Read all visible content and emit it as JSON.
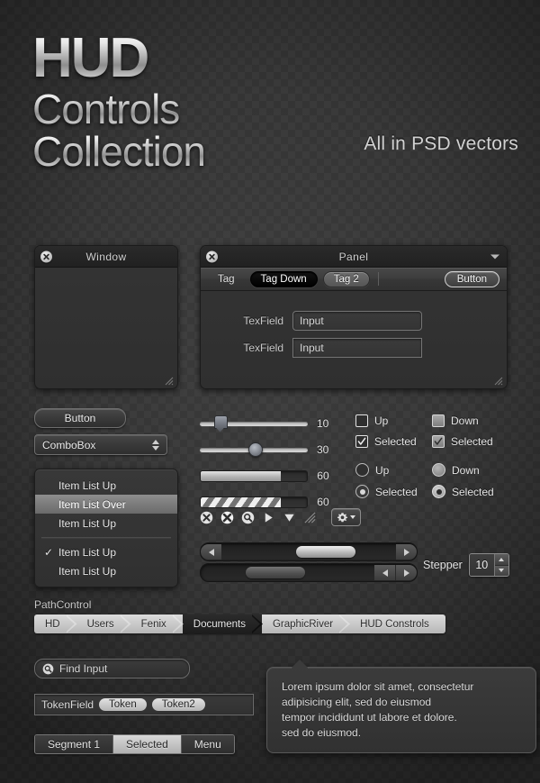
{
  "header": {
    "title_line1": "HUD",
    "title_line2": "Controls",
    "title_line3": "Collection",
    "subtitle": "All in PSD vectors"
  },
  "window_panel": {
    "title": "Window",
    "close_icon": "close-circle-icon",
    "resize_grip": "resize-grip-icon"
  },
  "panel": {
    "title": "Panel",
    "close_icon": "close-circle-icon",
    "menu_caret_icon": "chevron-down-icon",
    "toolbar": {
      "tabs": [
        {
          "label": "Tag",
          "state": "plain"
        },
        {
          "label": "Tag Down",
          "state": "down"
        },
        {
          "label": "Tag 2",
          "state": "alt"
        }
      ],
      "button_label": "Button"
    },
    "fields": [
      {
        "label": "TexField",
        "value": "Input",
        "shape": "rounded"
      },
      {
        "label": "TexField",
        "value": "Input",
        "shape": "square"
      }
    ],
    "resize_grip": "resize-grip-icon"
  },
  "button": {
    "label": "Button"
  },
  "combobox": {
    "value": "ComboBox",
    "arrows_icon": "updown-arrows-icon"
  },
  "item_list": {
    "group_one": [
      {
        "label": "Item List Up",
        "state": "up",
        "checked": false
      },
      {
        "label": "Item List Over",
        "state": "over",
        "checked": false
      },
      {
        "label": "Item List Up",
        "state": "up",
        "checked": false
      }
    ],
    "group_two": [
      {
        "label": "Item List Up",
        "state": "up",
        "checked": true
      },
      {
        "label": "Item List Up",
        "state": "up",
        "checked": false
      }
    ],
    "check_glyph": "✓"
  },
  "sliders": [
    {
      "kind": "slider-pointer",
      "value": "10",
      "fill_percent": 13
    },
    {
      "kind": "slider-round",
      "value": "30",
      "fill_percent": 41
    },
    {
      "kind": "progress-solid",
      "value": "60",
      "fill_percent": 75
    },
    {
      "kind": "progress-striped",
      "value": "60",
      "fill_percent": 75
    }
  ],
  "checkboxes": [
    {
      "label": "Up",
      "style": "up"
    },
    {
      "label": "Down",
      "style": "down"
    },
    {
      "label": "Selected",
      "style": "sel"
    },
    {
      "label": "Selected",
      "style": "seld"
    }
  ],
  "radios": [
    {
      "label": "Up",
      "style": "up"
    },
    {
      "label": "Down",
      "style": "down"
    },
    {
      "label": "Selected",
      "style": "sel"
    },
    {
      "label": "Selected",
      "style": "seld"
    }
  ],
  "icon_row": {
    "icons": [
      "close-circle-icon",
      "close-circle-bold-icon",
      "search-circle-icon",
      "play-triangle-icon",
      "dropdown-triangle-icon",
      "resize-grip-icon"
    ],
    "gear_button": {
      "gear_icon": "gear-icon",
      "caret_icon": "chevron-down-icon"
    }
  },
  "scrollbars": [
    {
      "name": "scrollbar-light",
      "left_arrow_icon": "arrow-left-icon",
      "right_arrow_icon": "arrow-right-icon",
      "thumb_left_percent": 43,
      "thumb_width_percent": 34,
      "arrows_position": "split"
    },
    {
      "name": "scrollbar-dark",
      "left_arrow_icon": "arrow-left-icon",
      "right_arrow_icon": "arrow-right-icon",
      "thumb_left_percent": 26,
      "thumb_width_percent": 34,
      "arrows_position": "right"
    }
  ],
  "stepper": {
    "label": "Stepper",
    "value": "10",
    "up_icon": "arrow-up-icon",
    "down_icon": "arrow-down-icon"
  },
  "path_control": {
    "label": "PathControl",
    "crumbs": [
      {
        "label": "HD",
        "style": "light"
      },
      {
        "label": "Users",
        "style": "light"
      },
      {
        "label": "Fenix",
        "style": "light"
      },
      {
        "label": "Documents",
        "style": "dark"
      },
      {
        "label": "GraphicRiver",
        "style": "light"
      },
      {
        "label": "HUD Constrols",
        "style": "light"
      }
    ]
  },
  "find_input": {
    "icon": "search-circle-icon",
    "value": "Find Input"
  },
  "token_field": {
    "label": "TokenField",
    "tokens": [
      "Token",
      "Token2"
    ]
  },
  "segmented_control": {
    "segments": [
      {
        "label": "Segment 1",
        "selected": false
      },
      {
        "label": "Selected",
        "selected": true
      },
      {
        "label": "Menu",
        "selected": false
      }
    ]
  },
  "popover": {
    "lines": [
      "Lorem ipsum dolor sit amet, consectetur",
      "adipisicing elit, sed do eiusmod",
      "tempor incididunt ut labore et dolore.",
      "sed do eiusmod."
    ]
  },
  "colors": {
    "background": "#343434",
    "panel_bg": "#313131",
    "titlebar": "#232323",
    "accent_light": "#d8d8d8",
    "text": "#e2e2e2",
    "highlight": "#8e8e8e"
  }
}
